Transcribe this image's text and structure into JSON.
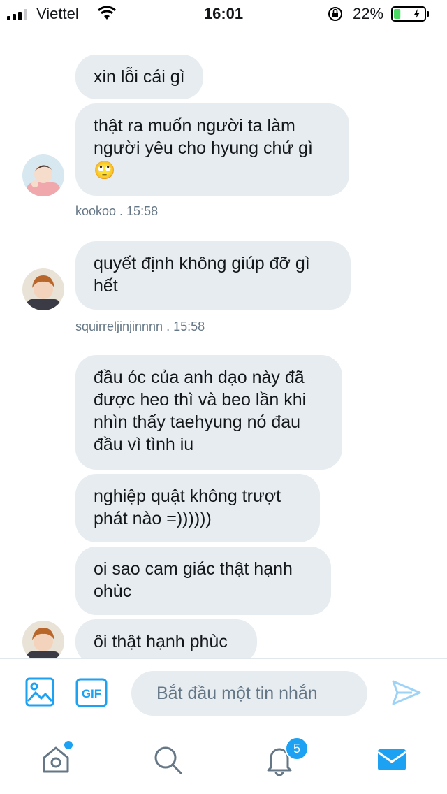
{
  "status_bar": {
    "carrier": "Viettel",
    "time": "16:01",
    "battery_percent": "22%",
    "battery_level": 0.22,
    "signal_bars": 3
  },
  "messages": [
    {
      "sender": "kookoo",
      "avatar_icon": "pink-sweater-boy-avatar",
      "bubbles": [
        "xin lỗi cái gì",
        "thật ra muốn người ta làm người yêu cho hyung chứ gì 🙄"
      ],
      "meta": "kookoo  . 15:58"
    },
    {
      "sender": "squirreljinjinnnn",
      "avatar_icon": "brown-hair-boy-avatar",
      "bubbles": [
        "quyết định không giúp đỡ gì hết"
      ],
      "meta": "squirreljinjinnnn  . 15:58"
    },
    {
      "sender": "squirreljinjinnnn",
      "avatar_icon": "brown-hair-boy-avatar",
      "bubbles": [
        "đầu óc của anh dạo này đã được heo thì và beo lần khi nhìn thấy taehyung nó đau đầu vì tình iu",
        "nghiệp quật không trượt phát nào =))))))",
        "oi sao cam giác thật hạnh ohùc",
        "ôi thật hạnh phùc"
      ]
    }
  ],
  "composer": {
    "placeholder": "Bắt đầu một tin nhắn",
    "gif_label": "GIF",
    "image_icon": "image-icon",
    "send_icon": "send-icon"
  },
  "tabbar": {
    "home_icon": "home-icon",
    "search_icon": "search-icon",
    "notifications_icon": "bell-icon",
    "notifications_count": "5",
    "messages_icon": "mail-icon"
  },
  "colors": {
    "accent": "#1da1f2",
    "bubble": "#e6ecf0",
    "meta": "#657786"
  }
}
